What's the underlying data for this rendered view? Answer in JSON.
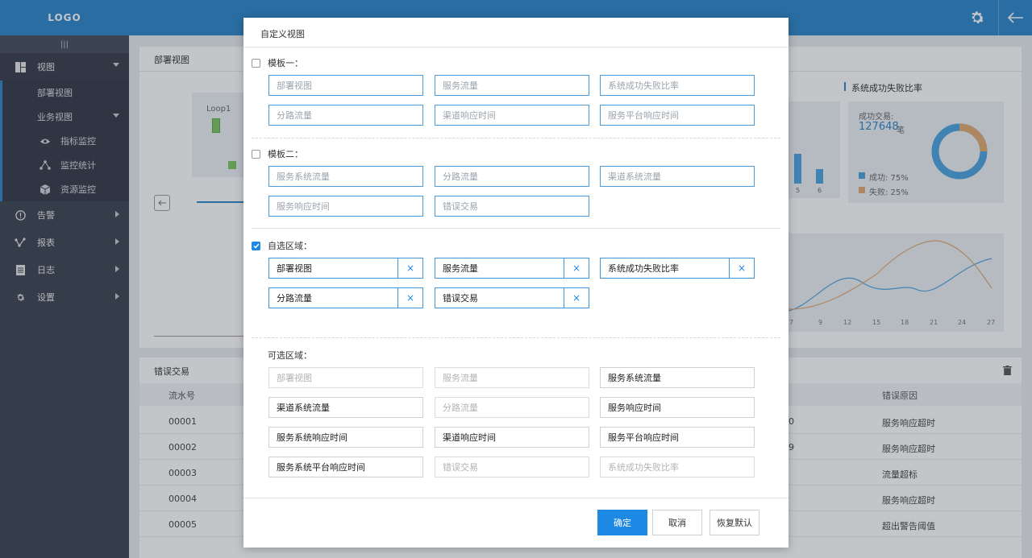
{
  "header": {
    "logo": "LOGO",
    "settings_icon": "gear-icon",
    "back_icon": "arrow-left-icon",
    "accent": "#2a86c9"
  },
  "sidebar": {
    "handle": "|||",
    "items": [
      {
        "label": "视图",
        "icon": "dashboard-icon"
      },
      {
        "label": "告警",
        "icon": "alert-circle-icon"
      },
      {
        "label": "报表",
        "icon": "chart-icon"
      },
      {
        "label": "日志",
        "icon": "document-icon"
      },
      {
        "label": "设置",
        "icon": "gear-icon"
      }
    ],
    "view_sub": {
      "deploy": "部署视图",
      "business": "业务视图",
      "metric": "指标监控",
      "stats": "监控统计",
      "resource": "资源监控"
    }
  },
  "background": {
    "deploy_title": "部署视图",
    "loop": "Loop1",
    "ratio_title": "系统成功失败比率",
    "success_label": "成功交易:",
    "success_count": "127648",
    "success_unit": "笔",
    "legend_success": "成功: 75%",
    "legend_fail": "失败: 25%",
    "bar_ticks": [
      "5",
      "6"
    ],
    "line_ticks": [
      "7",
      "9",
      "12",
      "15",
      "18",
      "21",
      "24",
      "27"
    ],
    "error_title": "错误交易",
    "col_serial": "流水号",
    "col_reason": "错误原因",
    "rows": [
      {
        "serial": "00001",
        "mid": "0",
        "reason": "服务响应超时"
      },
      {
        "serial": "00002",
        "mid": "9",
        "reason": "服务响应超时"
      },
      {
        "serial": "00003",
        "mid": "",
        "reason": "流量超标"
      },
      {
        "serial": "00004",
        "mid": "",
        "reason": "服务响应超时"
      },
      {
        "serial": "00005",
        "mid": "",
        "reason": "超出警告阈值"
      }
    ]
  },
  "modal": {
    "title": "自定义视图",
    "template1": {
      "label": "模板一：",
      "items": [
        "部署视图",
        "服务流量",
        "系统成功失败比率",
        "分路流量",
        "渠道响应时间",
        "服务平台响应时间"
      ]
    },
    "template2": {
      "label": "模板二：",
      "items": [
        "服务系统流量",
        "分路流量",
        "渠道系统流量",
        "服务响应时间",
        "错误交易"
      ]
    },
    "custom": {
      "label": "自选区域：",
      "items": [
        "部署视图",
        "服务流量",
        "系统成功失败比率",
        "分路流量",
        "错误交易"
      ]
    },
    "optional": {
      "label": "可选区域：",
      "items": [
        {
          "label": "部署视图",
          "disabled": true
        },
        {
          "label": "服务流量",
          "disabled": true
        },
        {
          "label": "服务系统流量",
          "disabled": false
        },
        {
          "label": "渠道系统流量",
          "disabled": false
        },
        {
          "label": "分路流量",
          "disabled": true
        },
        {
          "label": "服务响应时间",
          "disabled": false
        },
        {
          "label": "服务系统响应时间",
          "disabled": false
        },
        {
          "label": "渠道响应时间",
          "disabled": false
        },
        {
          "label": "服务平台响应时间",
          "disabled": false
        },
        {
          "label": "服务系统平台响应时间",
          "disabled": false
        },
        {
          "label": "错误交易",
          "disabled": true
        },
        {
          "label": "系统成功失败比率",
          "disabled": true
        }
      ]
    },
    "remove_glyph": "×",
    "buttons": {
      "ok": "确定",
      "cancel": "取消",
      "reset": "恢复默认"
    }
  }
}
